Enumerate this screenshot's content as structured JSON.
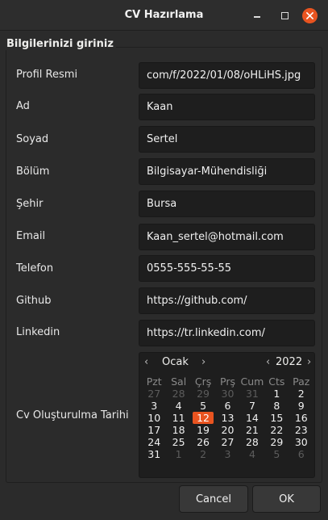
{
  "window": {
    "title": "CV Hazırlama"
  },
  "form": {
    "group_label": "Bilgilerinizi giriniz",
    "fields": [
      {
        "label": "Profil Resmi",
        "value": "com/f/2022/01/08/oHLiHS.jpg"
      },
      {
        "label": "Ad",
        "value": "Kaan"
      },
      {
        "label": "Soyad",
        "value": "Sertel"
      },
      {
        "label": "Bölüm",
        "value": "Bilgisayar-Mühendisliği"
      },
      {
        "label": "Şehir",
        "value": "Bursa"
      },
      {
        "label": "Email",
        "value": "Kaan_sertel@hotmail.com"
      },
      {
        "label": "Telefon",
        "value": "0555-555-55-55"
      },
      {
        "label": "Github",
        "value": "https://github.com/"
      },
      {
        "label": "Linkedin",
        "value": "https://tr.linkedin.com/"
      }
    ],
    "date_label": "Cv Oluşturulma Tarihi"
  },
  "calendar": {
    "month": "Ocak",
    "year": "2022",
    "prev_arrow": "‹",
    "next_arrow": "›",
    "weekdays": [
      "Pzt",
      "Sal",
      "Çrş",
      "Prş",
      "Cum",
      "Cts",
      "Paz"
    ],
    "days": [
      [
        "27",
        "28",
        "29",
        "30",
        "31",
        "1",
        "2"
      ],
      [
        "3",
        "4",
        "5",
        "6",
        "7",
        "8",
        "9"
      ],
      [
        "10",
        "11",
        "12",
        "13",
        "14",
        "15",
        "16"
      ],
      [
        "17",
        "18",
        "19",
        "20",
        "21",
        "22",
        "23"
      ],
      [
        "24",
        "25",
        "26",
        "27",
        "28",
        "29",
        "30"
      ],
      [
        "31",
        "1",
        "2",
        "3",
        "4",
        "5",
        "6"
      ]
    ],
    "selected_day": "12",
    "accent_color": "#e95420"
  },
  "buttons": {
    "cancel": "Cancel",
    "ok": "OK"
  }
}
